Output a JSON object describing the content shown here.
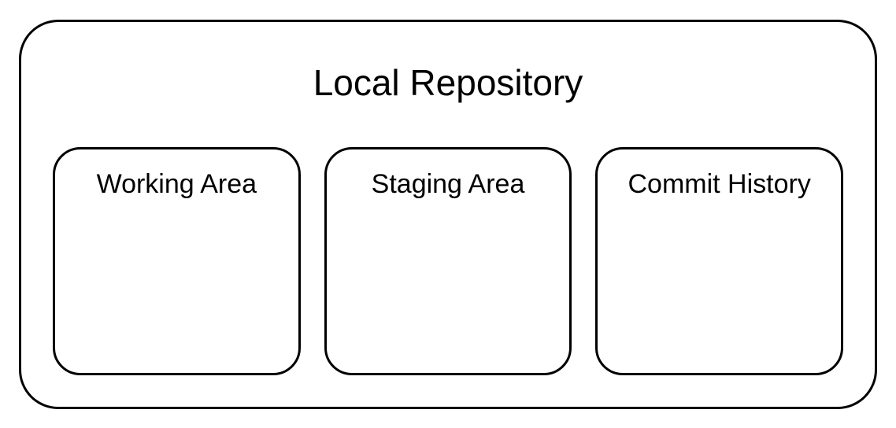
{
  "repository": {
    "title": "Local Repository",
    "sections": {
      "working": "Working Area",
      "staging": "Staging Area",
      "commit": "Commit History"
    }
  }
}
